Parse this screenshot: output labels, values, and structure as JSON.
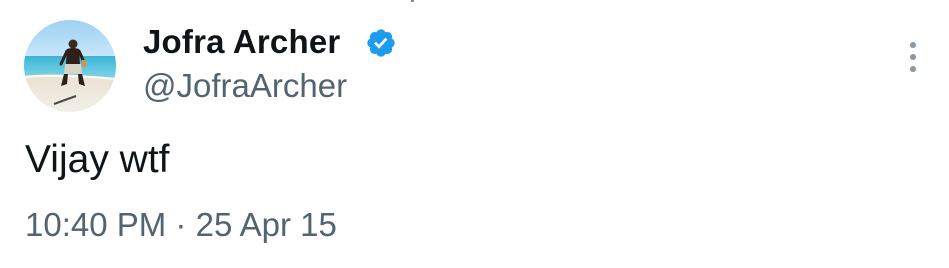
{
  "tweet": {
    "author_name": "Jofra Archer",
    "author_handle": "@JofraArcher",
    "verified": true,
    "text": "Vijay wtf",
    "time": "10:40 PM",
    "separator": "·",
    "date": "25 Apr 15"
  },
  "icons": {
    "avatar": "profile-photo-beach",
    "badge": "verified-check-icon",
    "more": "more-options-vertical-icon"
  },
  "colors": {
    "name": "#0f1419",
    "secondary": "#536471",
    "verified": "#1d9bf0",
    "more_dots": "#8a98a5"
  }
}
